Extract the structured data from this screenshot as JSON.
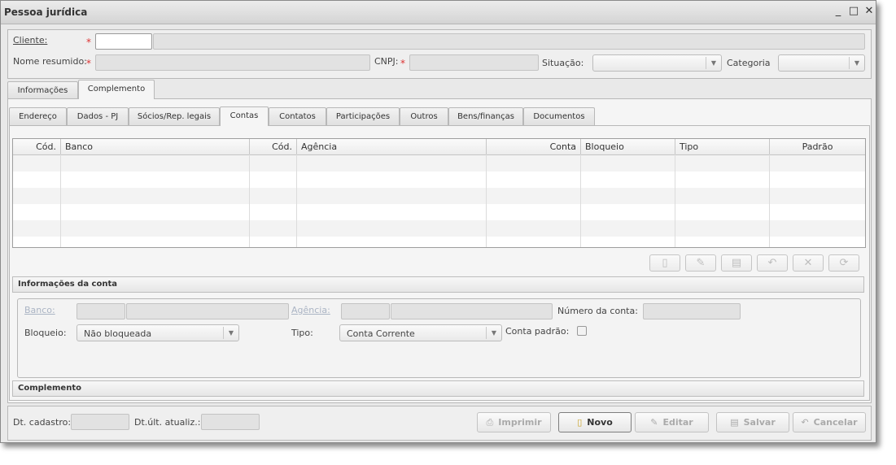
{
  "window": {
    "title": "Pessoa jurídica",
    "controls": [
      "_",
      "□",
      "✕"
    ]
  },
  "header": {
    "cliente_label": "Cliente:",
    "nome_resumido_label": "Nome resumido:",
    "cnpj_label": "CNPJ:",
    "situacao_label": "Situação:",
    "categoria_label": "Categoria",
    "required_mark": "*"
  },
  "main_tabs": [
    {
      "label": "Informações",
      "active": false
    },
    {
      "label": "Complemento",
      "active": true
    }
  ],
  "sub_tabs": [
    {
      "label": "Endereço",
      "active": false
    },
    {
      "label": "Dados - PJ",
      "active": false
    },
    {
      "label": "Sócios/Rep. legais",
      "active": false
    },
    {
      "label": "Contas",
      "active": true
    },
    {
      "label": "Contatos",
      "active": false
    },
    {
      "label": "Participações",
      "active": false
    },
    {
      "label": "Outros",
      "active": false
    },
    {
      "label": "Bens/finanças",
      "active": false
    },
    {
      "label": "Documentos",
      "active": false
    }
  ],
  "table": {
    "columns": [
      "Cód.",
      "Banco",
      "Cód.",
      "Agência",
      "Conta",
      "Bloqueio",
      "Tipo",
      "Padrão"
    ],
    "rows": []
  },
  "toolbar_icons": [
    "new-icon",
    "edit-icon",
    "save-icon",
    "undo-icon",
    "delete-icon",
    "refresh-icon"
  ],
  "account_info": {
    "section_title": "Informações da conta",
    "banco_label": "Banco:",
    "agencia_label": "Agência:",
    "numero_conta_label": "Número da conta:",
    "bloqueio_label": "Bloqueio:",
    "bloqueio_value": "Não bloqueada",
    "tipo_label": "Tipo:",
    "tipo_value": "Conta Corrente",
    "conta_padrao_label": "Conta padrão:",
    "conta_padrao_checked": false
  },
  "complemento_section": {
    "title": "Complemento"
  },
  "footer": {
    "dt_cadastro_label": "Dt. cadastro:",
    "dt_ult_atualiz_label": "Dt.últ. atualiz.:",
    "imprimir": "Imprimir",
    "novo": "Novo",
    "editar": "Editar",
    "salvar": "Salvar",
    "cancelar": "Cancelar"
  },
  "colors": {
    "required": "#dd3333",
    "disabled_link": "#aab4c4",
    "panel": "#efefef"
  }
}
